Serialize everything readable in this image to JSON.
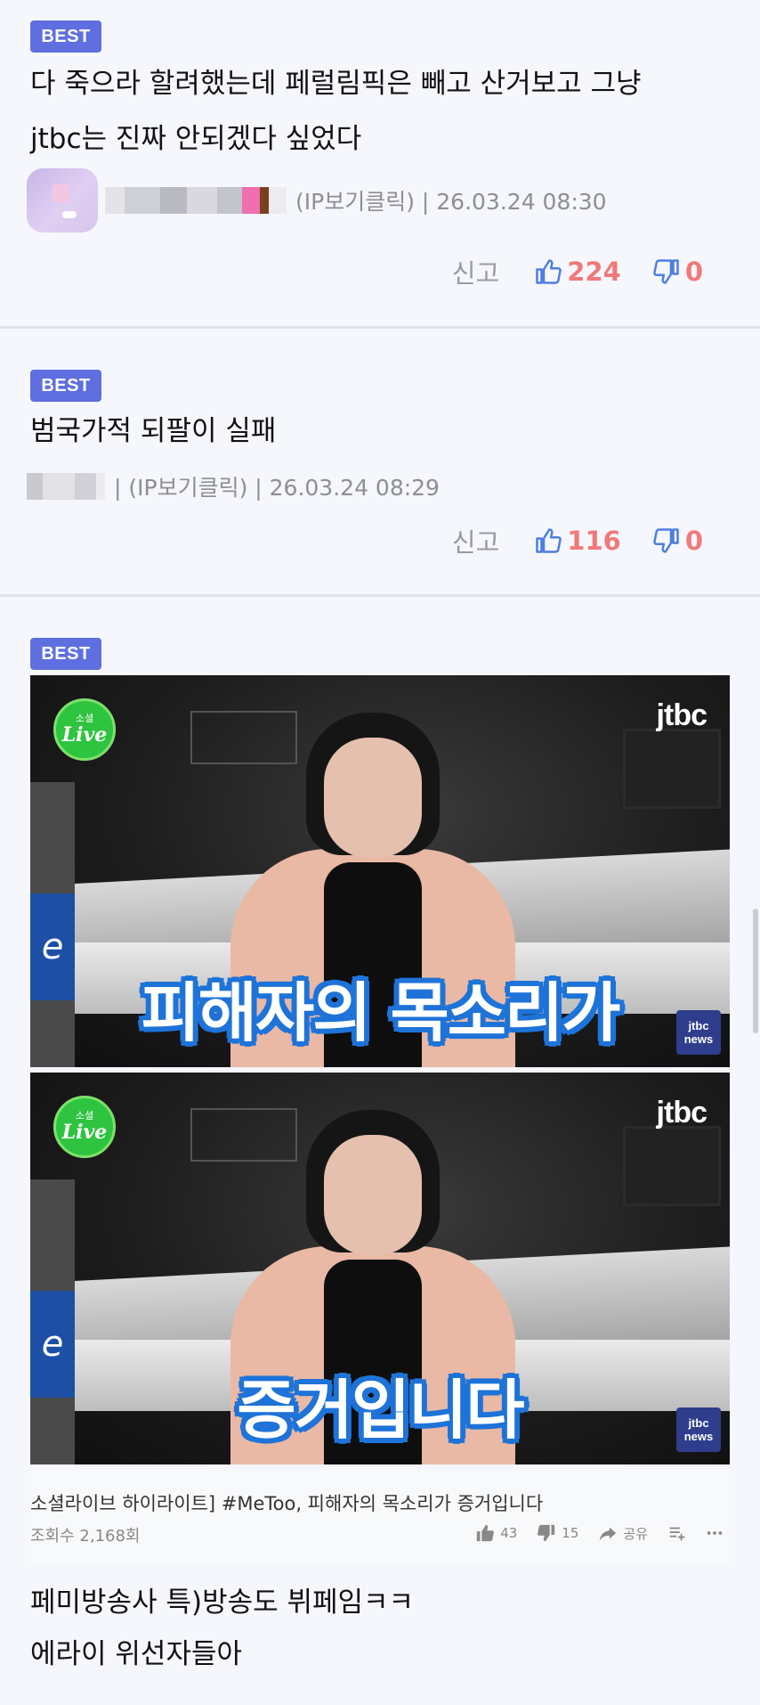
{
  "comments": [
    {
      "badge": "BEST",
      "text": "다 죽으라 할려했는데 페럴림픽은 빼고 산거보고 그냥\njtbc는 진짜 안되겠다 싶었다",
      "meta": "(IP보기클릭) | 26.03.24 08:30",
      "report_label": "신고",
      "likes": "224",
      "dislikes": "0"
    },
    {
      "badge": "BEST",
      "text": "범국가적 되팔이 실패",
      "meta": "| (IP보기클릭) | 26.03.24 08:29",
      "report_label": "신고",
      "likes": "116",
      "dislikes": "0"
    }
  ],
  "post": {
    "badge": "BEST",
    "video": {
      "live_badge_top": "소셜",
      "live_badge_main": "Live",
      "channel_logo": "jtbc",
      "news_badge_top": "jtbc",
      "news_badge_bottom": "news",
      "frame1_caption": "피해자의 목소리가",
      "frame2_caption": "증거입니다",
      "side_box_text": "e",
      "title": "소셜라이브 하이라이트] #MeToo, 피해자의 목소리가 증거입니다",
      "views": "조회수 2,168회",
      "like_count": "43",
      "dislike_count": "15",
      "share_label": "공유"
    },
    "text": "페미방송사 특)방송도 뷔페임ㅋㅋ\n에라이 위선자들아"
  },
  "colors": {
    "badge": "#5f6fe0",
    "vote": "#f07a7a",
    "background": "#f5f7fc",
    "caption_outline": "#1e73d8"
  },
  "icons": [
    "thumbs-up-icon",
    "thumbs-down-icon",
    "share-icon",
    "add-to-playlist-icon",
    "more-icon"
  ]
}
